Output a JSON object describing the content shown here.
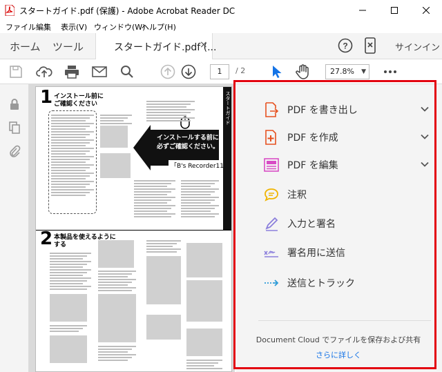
{
  "window": {
    "title": "スタートガイド.pdf (保護) - Adobe Acrobat Reader DC"
  },
  "menu": [
    "ファイル",
    "編集",
    "表示(V)",
    "ウィンドウ(W)",
    "ヘルプ(H)"
  ],
  "tabs": {
    "home": "ホーム",
    "tools": "ツール",
    "document": "スタートガイド.pdf (...",
    "close": "×",
    "signin": "サインイン"
  },
  "toolbar": {
    "page_current": "1",
    "page_total": "/  2",
    "zoom": "27.8%",
    "zoom_arrow": "▼"
  },
  "document": {
    "step1_number": "1",
    "step1_heading": [
      "インストール前に",
      "ご確認ください"
    ],
    "callout": [
      "インストールする前に",
      "必ずご確認ください。"
    ],
    "callout_tag": "「B's Recorder11」",
    "sidebar_strip": "スタートガイド",
    "step2_number": "2",
    "step2_heading": [
      "本製品を使えるように",
      "する"
    ]
  },
  "tools_pane": {
    "items": [
      {
        "label": "PDF を書き出し",
        "icon": "export-pdf-icon",
        "color": "#e6501e",
        "expandable": true
      },
      {
        "label": "PDF を作成",
        "icon": "create-pdf-icon",
        "color": "#e6501e",
        "expandable": true
      },
      {
        "label": "PDF を編集",
        "icon": "edit-pdf-icon",
        "color": "#d84cc5",
        "expandable": true
      },
      {
        "label": "注釈",
        "icon": "comment-icon",
        "color": "#f0b400",
        "expandable": false
      },
      {
        "label": "入力と署名",
        "icon": "fill-sign-icon",
        "color": "#8b7fdc",
        "expandable": false
      },
      {
        "label": "署名用に送信",
        "icon": "send-for-signature-icon",
        "color": "#8b7fdc",
        "expandable": false
      },
      {
        "label": "送信とトラック",
        "icon": "send-track-icon",
        "color": "#2d9bd7",
        "expandable": false
      }
    ],
    "cloud_text": "Document Cloud でファイルを保存および共有",
    "cloud_link": "さらに詳しく"
  },
  "colors": {
    "highlight_frame": "#e3000f",
    "accent": "#1473e6"
  }
}
